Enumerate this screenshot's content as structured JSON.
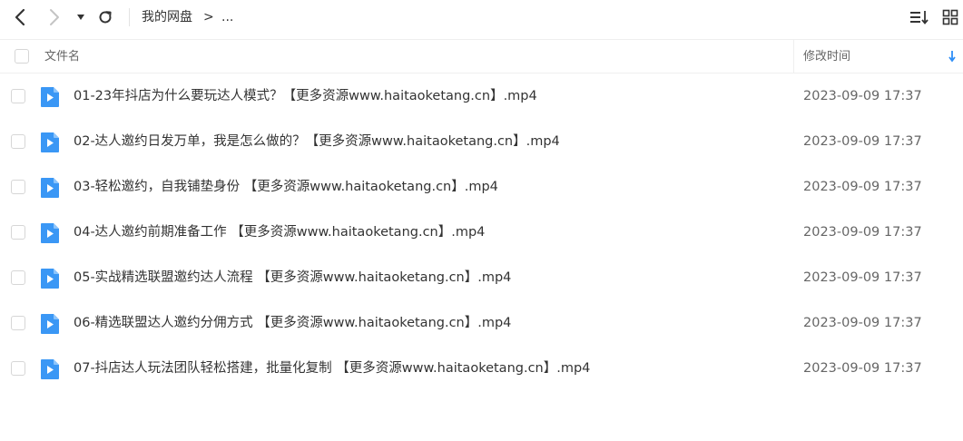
{
  "breadcrumb": {
    "root": "我的网盘",
    "separator": ">",
    "more": "..."
  },
  "header": {
    "name_col": "文件名",
    "time_col": "修改时间"
  },
  "colors": {
    "accent": "#2e8ef7",
    "icon_blue": "#3a97f5"
  },
  "files": [
    {
      "name": "01-23年抖店为什么要玩达人模式？【更多资源www.haitaoketang.cn】.mp4",
      "time": "2023-09-09 17:37"
    },
    {
      "name": "02-达人邀约日发万单，我是怎么做的？【更多资源www.haitaoketang.cn】.mp4",
      "time": "2023-09-09 17:37"
    },
    {
      "name": "03-轻松邀约，自我铺垫身份 【更多资源www.haitaoketang.cn】.mp4",
      "time": "2023-09-09 17:37"
    },
    {
      "name": "04-达人邀约前期准备工作 【更多资源www.haitaoketang.cn】.mp4",
      "time": "2023-09-09 17:37"
    },
    {
      "name": "05-实战精选联盟邀约达人流程 【更多资源www.haitaoketang.cn】.mp4",
      "time": "2023-09-09 17:37"
    },
    {
      "name": "06-精选联盟达人邀约分佣方式 【更多资源www.haitaoketang.cn】.mp4",
      "time": "2023-09-09 17:37"
    },
    {
      "name": "07-抖店达人玩法团队轻松搭建，批量化复制 【更多资源www.haitaoketang.cn】.mp4",
      "time": "2023-09-09 17:37"
    }
  ]
}
